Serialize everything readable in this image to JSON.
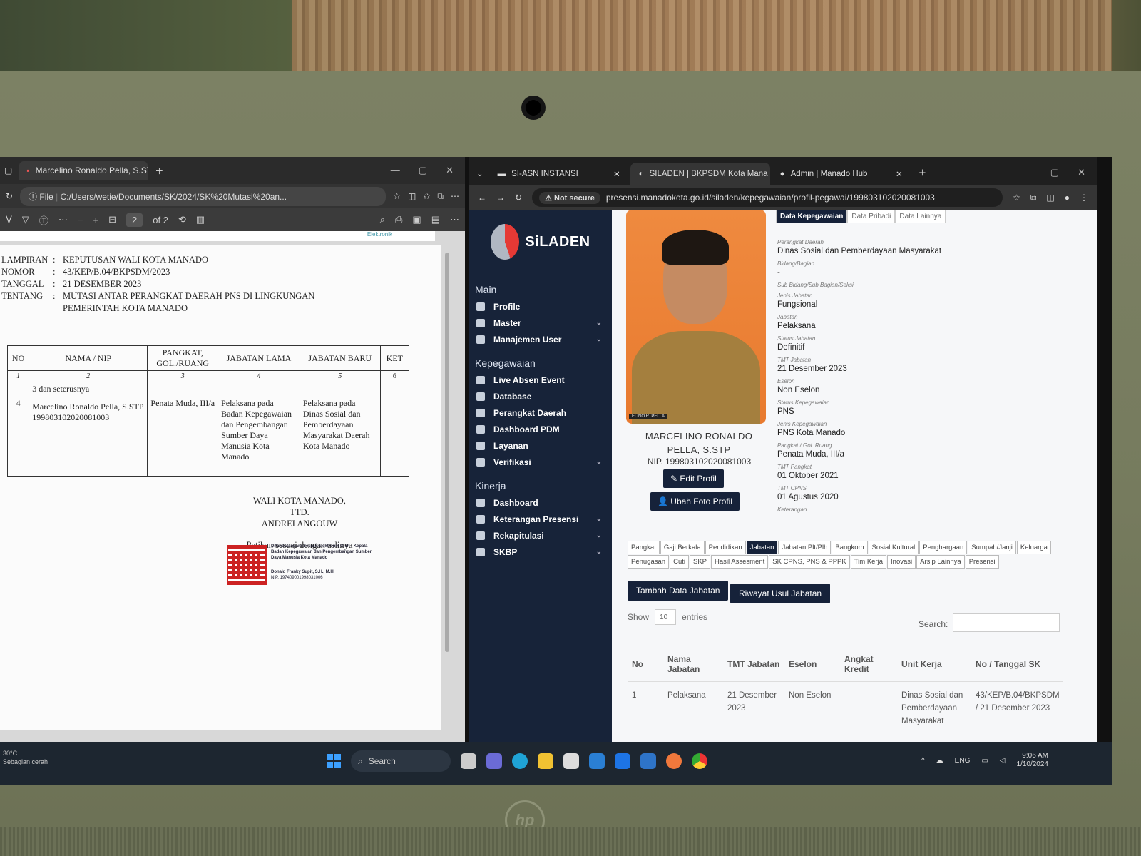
{
  "pdf": {
    "tab_title": "Marcelino Ronaldo Pella, S.STP....",
    "file_label": "File",
    "url": "C:/Users/wetie/Documents/SK/2024/SK%20Mutasi%20an...",
    "page_current": "2",
    "page_total": "of 2",
    "header_logo_text": "Elektronik",
    "meta": [
      {
        "key": "LAMPIRAN",
        "value": "KEPUTUSAN WALI KOTA MANADO"
      },
      {
        "key": "NOMOR",
        "value": "43/KEP/B.04/BKPSDM/2023"
      },
      {
        "key": "TANGGAL",
        "value": "21 DESEMBER 2023"
      },
      {
        "key": "TENTANG",
        "value": "MUTASI ANTAR PERANGKAT DAERAH PNS DI LINGKUNGAN PEMERINTAH KOTA MANADO"
      }
    ],
    "table_headers": [
      "NO",
      "NAMA / NIP",
      "PANGKAT, GOL./RUANG",
      "JABATAN LAMA",
      "JABATAN BARU",
      "KET"
    ],
    "table_numbers": [
      "1",
      "2",
      "3",
      "4",
      "5",
      "6"
    ],
    "continued": "3 dan seterusnya",
    "row": {
      "no": "4",
      "nama": "Marcelino Ronaldo Pella, S.STP",
      "nip": "199803102020081003",
      "pangkat": "Penata Muda, III/a",
      "jabatan_lama": "Pelaksana pada Badan Kepegawaian dan Pengembangan Sumber Daya Manusia Kota Manado",
      "jabatan_baru": "Pelaksana pada Dinas Sosial dan Pemberdayaan Masyarakat Daerah Kota Manado"
    },
    "sign_lines": [
      "WALI KOTA MANADO,",
      "TTD.",
      "ANDREI ANGOUW"
    ],
    "petikan": "Petikan sesuai dengan aslinya",
    "esign_text": "Ditandatangani Secara Elektronik Oleh : Kepala Badan Kepegawaian dan Pengembangan Sumber Daya Manusia Kota Manado",
    "esign_name": "Donald Franky Supit, S.H., M.H.",
    "esign_nip": "NIP. 197409001998031006"
  },
  "taskbar": {
    "weather_temp": "30°C",
    "weather_desc": "Sebagian cerah",
    "search": "Search",
    "lang": "ENG",
    "time": "9:06 AM",
    "date": "1/10/2024"
  },
  "browser": {
    "tabs": [
      {
        "title": "SI-ASN INSTANSI"
      },
      {
        "title": "SILADEN | BKPSDM Kota Mana"
      },
      {
        "title": "Admin | Manado Hub"
      }
    ],
    "not_secure": "Not secure",
    "url": "presensi.manadokota.go.id/siladen/kepegawaian/profil-pegawai/199803102020081003"
  },
  "sidebar": {
    "logo": "SiLADEN",
    "sections": [
      {
        "title": "Main",
        "items": [
          {
            "label": "Profile",
            "chevron": false
          },
          {
            "label": "Master",
            "chevron": true
          },
          {
            "label": "Manajemen User",
            "chevron": true
          }
        ]
      },
      {
        "title": "Kepegawaian",
        "items": [
          {
            "label": "Live Absen Event",
            "chevron": false
          },
          {
            "label": "Database",
            "chevron": false
          },
          {
            "label": "Perangkat Daerah",
            "chevron": false
          },
          {
            "label": "Dashboard PDM",
            "chevron": false
          },
          {
            "label": "Layanan",
            "chevron": false
          },
          {
            "label": "Verifikasi",
            "chevron": true
          }
        ]
      },
      {
        "title": "Kinerja",
        "items": [
          {
            "label": "Dashboard",
            "chevron": false
          },
          {
            "label": "Keterangan Presensi",
            "chevron": true
          },
          {
            "label": "Rekapitulasi",
            "chevron": true
          },
          {
            "label": "SKBP",
            "chevron": true
          }
        ]
      }
    ]
  },
  "profile": {
    "photo_nameplate": "ELINO R. PELLA",
    "name": "MARCELINO RONALDO PELLA, S.STP",
    "nip": "NIP. 199803102020081003",
    "edit_button": "Edit Profil",
    "photo_button": "Ubah Foto Profil",
    "tabs": [
      "Data Kepegawaian",
      "Data Pribadi",
      "Data Lainnya"
    ],
    "fields": [
      {
        "label": "Perangkat Daerah",
        "value": "Dinas Sosial dan Pemberdayaan Masyarakat"
      },
      {
        "label": "Bidang/Bagian",
        "value": "-"
      },
      {
        "label": "Sub Bidang/Sub Bagian/Seksi",
        "value": ""
      },
      {
        "label": "Jenis Jabatan",
        "value": "Fungsional"
      },
      {
        "label": "Jabatan",
        "value": "Pelaksana"
      },
      {
        "label": "Status Jabatan",
        "value": "Definitif"
      },
      {
        "label": "TMT Jabatan",
        "value": "21 Desember 2023"
      },
      {
        "label": "Eselon",
        "value": "Non Eselon"
      },
      {
        "label": "Status Kepegawaian",
        "value": "PNS"
      },
      {
        "label": "Jenis Kepegawaian",
        "value": "PNS Kota Manado"
      },
      {
        "label": "Pangkat / Gol. Ruang",
        "value": "Penata Muda, III/a"
      },
      {
        "label": "TMT Pangkat",
        "value": "01 Oktober 2021"
      },
      {
        "label": "TMT CPNS",
        "value": "01 Agustus 2020"
      },
      {
        "label": "Keterangan",
        "value": ""
      }
    ]
  },
  "history": {
    "tabs": [
      "Pangkat",
      "Gaji Berkala",
      "Pendidikan",
      "Jabatan",
      "Jabatan Plt/Plh",
      "Bangkom",
      "Sosial Kultural",
      "Penghargaan",
      "Sumpah/Janji",
      "Keluarga",
      "Penugasan",
      "Cuti",
      "SKP",
      "Hasil Assesment",
      "SK CPNS, PNS & PPPK",
      "Tim Kerja",
      "Inovasi",
      "Arsip Lainnya",
      "Presensi"
    ],
    "active_tab": "Jabatan",
    "add_button": "Tambah Data Jabatan",
    "history_button": "Riwayat Usul Jabatan",
    "show_label": "Show",
    "show_value": "10",
    "entries_label": "entries",
    "search_label": "Search:",
    "columns": [
      "No",
      "Nama Jabatan",
      "TMT Jabatan",
      "Eselon",
      "Angkat Kredit",
      "Unit Kerja",
      "No / Tanggal SK"
    ],
    "rows": [
      [
        "1",
        "Pelaksana",
        "21 Desember 2023",
        "Non Eselon",
        "",
        "Dinas Sosial dan Pemberdayaan Masyarakat",
        "43/KEP/B.04/BKPSDM / 21 Desember 2023"
      ]
    ]
  }
}
